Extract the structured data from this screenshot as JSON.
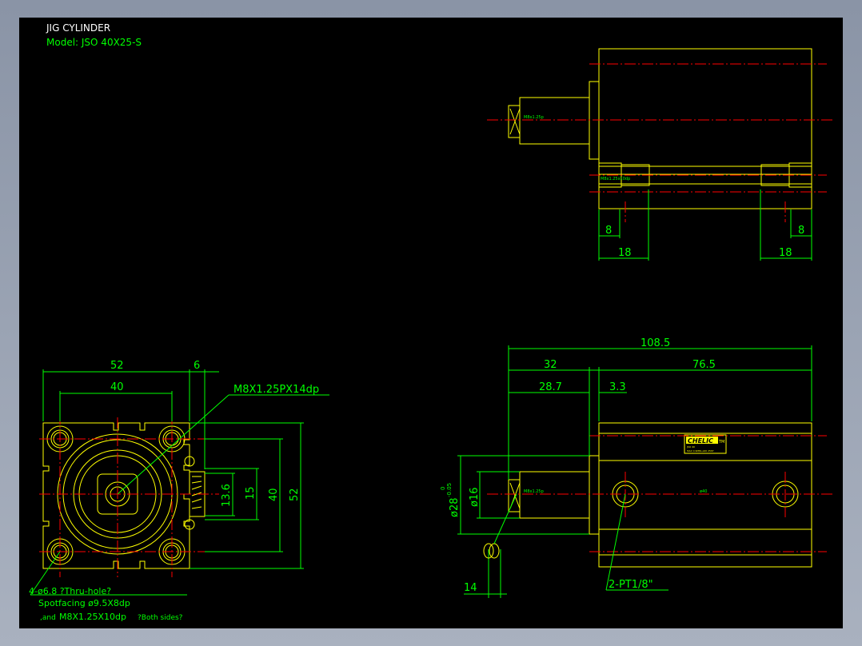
{
  "title_block": {
    "title": "JIG CYLINDER",
    "model": "Model:  JSO 40X25-S"
  },
  "side_view": {
    "thread_label": "M8x1.25p",
    "port_label": "M8x1.25x10dp",
    "dim_left_8": "8",
    "dim_left_18": "18",
    "dim_right_8": "8",
    "dim_right_18": "18"
  },
  "front_view": {
    "dim_52_top": "52",
    "dim_6": "6",
    "dim_40_top": "40",
    "thread_callout": "M8X1.25PX14dp",
    "dim_13_6": "13.6",
    "dim_15": "15",
    "dim_40_right": "40",
    "dim_52_right": "52",
    "note_line1": "4-ø6.8  ?Thru-hole?",
    "note_line2": "Spotfacing  ø9.5X8dp",
    "note_line3_prefix": ",and",
    "note_line3_main": "M8X1.25X10dp",
    "note_line3_suffix": "?Both sides?"
  },
  "plan_view": {
    "dim_108_5": "108.5",
    "dim_32": "32",
    "dim_76_5": "76.5",
    "dim_28_7": "28.7",
    "dim_3_3": "3.3",
    "dim_dia28": "ø28",
    "dim_dia28_tol_upper": "0",
    "dim_dia28_tol_lower": "-0.05",
    "dim_dia16": "ø16",
    "dim_14": "14",
    "port_callout": "2-PT1/8\"",
    "thread_label": "M8x1.25p",
    "bore_label": "ø40",
    "brand": "CHELIC",
    "brand_mark": "TM",
    "nameplate_line1": "JSO 40",
    "nameplate_line2": "MAX 0.9MPa ø40 25ST"
  },
  "colors": {
    "background": "#000000",
    "outline": "#ffff00",
    "dimension": "#00ff00",
    "centerline": "#ff0000",
    "title": "#ffffff"
  }
}
